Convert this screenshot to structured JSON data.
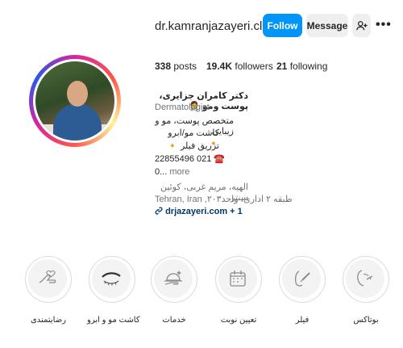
{
  "profile": {
    "username": "dr.kamranjazayeri.clinic",
    "follow_label": "Follow",
    "message_label": "Message",
    "more_label": "•••"
  },
  "stats": {
    "posts_count": "338",
    "posts_label": "posts",
    "followers_count": "19.4K",
    "followers_label": "followers",
    "following_count": "21",
    "following_label": "following"
  },
  "bio": {
    "name": "دکتر کامران جزایری، پوست ومو",
    "name_emoji": "👩‍⚕️",
    "category": "Dermatologist",
    "line1": "متخصص پوست، مو و زیبایی",
    "line2": "کاشت مو/ابرو",
    "line2_emoji": "🔸",
    "line3": "تزریق فیلر",
    "line3_emoji": "🔸",
    "phone": "22855496 021",
    "phone_emoji": "☎️",
    "more_prefix": "0...",
    "more_label": "more",
    "address1": "الهیه، مریم غربی، کوئین سنتر",
    "address2": "Tehran, Iran ,طبقه ۲ اداری، واحد۲۰۳",
    "link_text": "drjazayeri.com",
    "link_extra": "+ 1"
  },
  "highlights": [
    {
      "label": "رضایتمندی",
      "icon": "satisfaction-icon"
    },
    {
      "label": "کاشت مو و ابرو",
      "icon": "eyebrow-icon"
    },
    {
      "label": "خدمات",
      "icon": "services-icon"
    },
    {
      "label": "تعیین نوبت",
      "icon": "calendar-icon"
    },
    {
      "label": "فیلر",
      "icon": "filler-icon"
    },
    {
      "label": "بوتاکس",
      "icon": "botox-icon"
    }
  ],
  "colors": {
    "follow_button": "#0095f6",
    "secondary_button": "#efefef",
    "link": "#00376b"
  }
}
